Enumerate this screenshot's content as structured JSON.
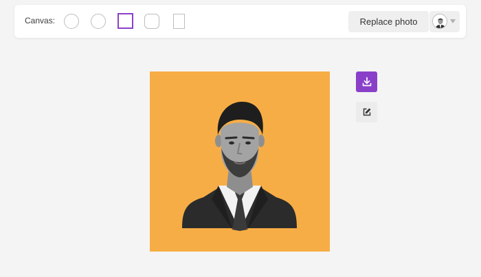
{
  "toolbar": {
    "canvas_label": "Canvas:",
    "shapes": [
      "circle",
      "circle",
      "square",
      "rounded-square",
      "portrait-rectangle"
    ],
    "selected_shape": "square",
    "replace_photo_label": "Replace photo"
  },
  "preview": {
    "background_color": "#f7ad45"
  },
  "actions": {
    "download_icon": "download-icon",
    "edit_icon": "edit-icon"
  },
  "colors": {
    "accent": "#8a3fc9",
    "page_background": "#f4f4f4"
  }
}
